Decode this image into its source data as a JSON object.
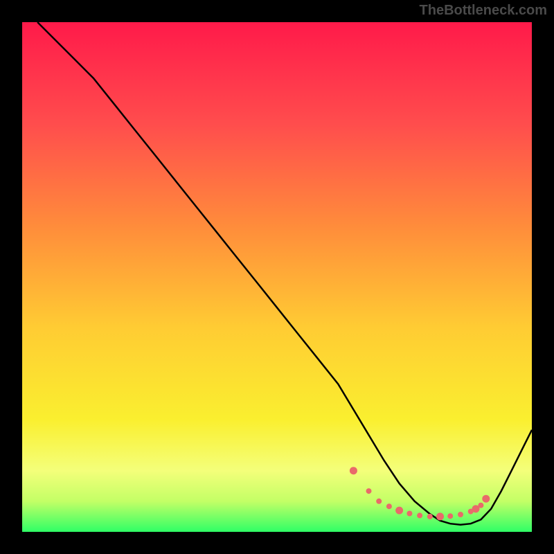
{
  "watermark": "TheBottleneck.com",
  "chart_data": {
    "type": "line",
    "title": "",
    "xlabel": "",
    "ylabel": "",
    "xlim": [
      0,
      100
    ],
    "ylim": [
      0,
      100
    ],
    "series": [
      {
        "name": "curve",
        "x": [
          3,
          6,
          10,
          14,
          18,
          22,
          26,
          30,
          34,
          38,
          42,
          46,
          50,
          54,
          58,
          62,
          65,
          68,
          71,
          74,
          77,
          80,
          82,
          84,
          86,
          88,
          90,
          92,
          94,
          96,
          98,
          100
        ],
        "y": [
          100,
          97,
          93,
          89,
          84,
          79,
          74,
          69,
          64,
          59,
          54,
          49,
          44,
          39,
          34,
          29,
          24,
          19,
          14,
          9.5,
          6,
          3.5,
          2.2,
          1.6,
          1.4,
          1.6,
          2.4,
          4.5,
          8,
          12,
          16,
          20
        ]
      }
    ],
    "dotted_region": {
      "x": [
        65,
        68,
        70,
        72,
        74,
        76,
        78,
        80,
        82,
        84,
        86,
        88,
        89,
        90,
        91
      ],
      "y": [
        12,
        8,
        6,
        5,
        4.2,
        3.6,
        3.2,
        3,
        3,
        3.1,
        3.4,
        4,
        4.5,
        5.2,
        6.5
      ]
    },
    "gradient_stops": [
      {
        "offset": 0,
        "color": "#ff1a4a"
      },
      {
        "offset": 20,
        "color": "#ff4d4d"
      },
      {
        "offset": 40,
        "color": "#ff8c3b"
      },
      {
        "offset": 60,
        "color": "#ffcc33"
      },
      {
        "offset": 78,
        "color": "#faef2f"
      },
      {
        "offset": 88,
        "color": "#f4ff7a"
      },
      {
        "offset": 94,
        "color": "#c3ff66"
      },
      {
        "offset": 100,
        "color": "#2fff66"
      }
    ],
    "dot_color": "#e96a6a",
    "curve_color": "#000000"
  }
}
